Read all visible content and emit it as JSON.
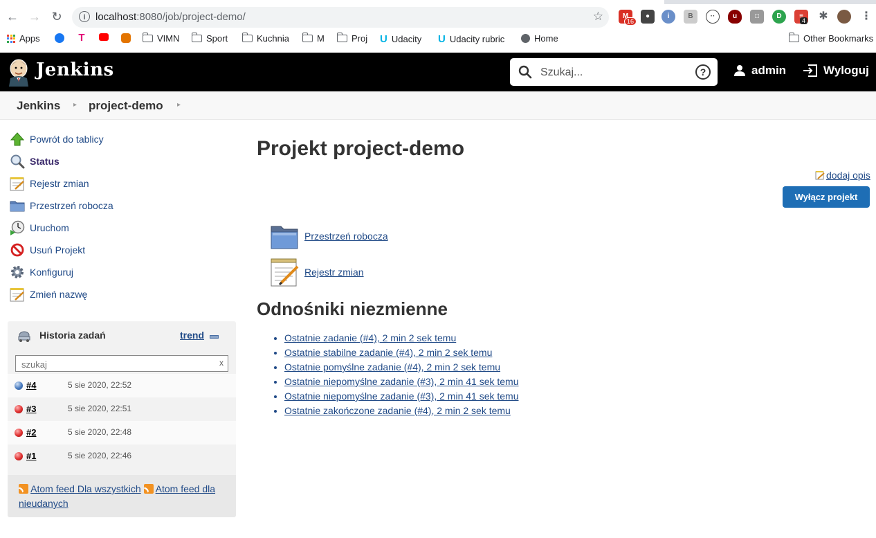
{
  "browser": {
    "url_host": "localhost",
    "url_rest": ":8080/job/project-demo/",
    "bookmarks": [
      {
        "label": "Apps",
        "icon": "apps-grid-icon"
      },
      {
        "label": "",
        "icon": "facebook-icon"
      },
      {
        "label": "",
        "icon": "t-mobile-icon"
      },
      {
        "label": "",
        "icon": "youtube-icon"
      },
      {
        "label": "",
        "icon": "app-icon"
      },
      {
        "label": "VIMN",
        "icon": "folder-icon"
      },
      {
        "label": "Sport",
        "icon": "folder-icon"
      },
      {
        "label": "Kuchnia",
        "icon": "folder-icon"
      },
      {
        "label": "M",
        "icon": "folder-icon"
      },
      {
        "label": "Proj",
        "icon": "folder-icon"
      },
      {
        "label": "Udacity",
        "icon": "udacity-icon"
      },
      {
        "label": "Udacity rubric",
        "icon": "udacity-icon"
      },
      {
        "label": "Home",
        "icon": "globe-icon"
      },
      {
        "label": "Other Bookmarks",
        "icon": "folder-icon"
      }
    ],
    "gmail_badge": "16",
    "todoist_badge": "4"
  },
  "header": {
    "title": "Jenkins",
    "search_placeholder": "Szukaj...",
    "help": "?",
    "user": "admin",
    "logout": "Wyloguj"
  },
  "breadcrumb": [
    "Jenkins",
    "project-demo"
  ],
  "sidebar": {
    "tasks": [
      {
        "label": "Powrót do tablicy",
        "icon": "up-arrow-icon"
      },
      {
        "label": "Status",
        "icon": "search-icon"
      },
      {
        "label": "Rejestr zmian",
        "icon": "notepad-icon"
      },
      {
        "label": "Przestrzeń robocza",
        "icon": "folder-icon"
      },
      {
        "label": "Uruchom",
        "icon": "clock-run-icon"
      },
      {
        "label": "Usuń Projekt",
        "icon": "no-entry-icon"
      },
      {
        "label": "Konfiguruj",
        "icon": "gear-icon"
      },
      {
        "label": "Zmień nazwę",
        "icon": "notepad-icon"
      }
    ]
  },
  "build_history": {
    "title": "Historia zadań",
    "trend": "trend",
    "filter_placeholder": "szukaj",
    "clear": "x",
    "builds": [
      {
        "number": "#4",
        "date": "5 sie 2020, 22:52",
        "status": "success"
      },
      {
        "number": "#3",
        "date": "5 sie 2020, 22:51",
        "status": "failed"
      },
      {
        "number": "#2",
        "date": "5 sie 2020, 22:48",
        "status": "failed"
      },
      {
        "number": "#1",
        "date": "5 sie 2020, 22:46",
        "status": "failed"
      }
    ],
    "feed_all": "Atom feed Dla wszystkich",
    "feed_failed": "Atom feed dla nieudanych"
  },
  "main": {
    "title": "Projekt project-demo",
    "add_description": "dodaj opis",
    "disable_button": "Wyłącz projekt",
    "workspace_link": "Przestrzeń robocza",
    "changes_link": "Rejestr zmian",
    "permalinks_title": "Odnośniki niezmienne",
    "permalinks": [
      "Ostatnie zadanie (#4), 2 min 2 sek temu",
      "Ostatnie stabilne zadanie (#4), 2 min 2 sek temu",
      "Ostatnie pomyślne zadanie (#4), 2 min 2 sek temu",
      "Ostatnie niepomyślne zadanie (#3), 2 min 41 sek temu",
      "Ostatnie niepomyślne zadanie (#3), 2 min 41 sek temu",
      "Ostatnie zakończone zadanie (#4), 2 min 2 sek temu"
    ]
  },
  "colors": {
    "header_bg": "#000000",
    "link": "#204a87",
    "primary_button": "#1e6eb5",
    "success_ball": "#4a7cc0",
    "failure_ball": "#e03030"
  }
}
